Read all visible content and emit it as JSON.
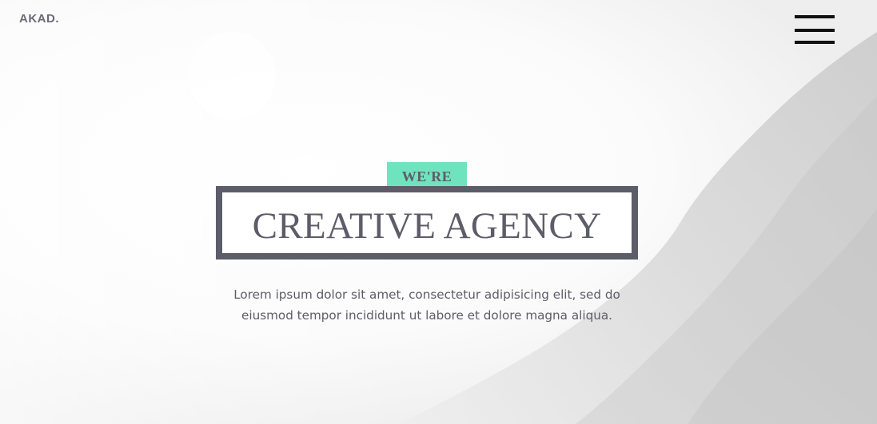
{
  "brand": {
    "logo_text": "AKAD."
  },
  "nav": {
    "menu_icon": "hamburger-menu-icon"
  },
  "hero": {
    "tagline": "WE'RE",
    "headline": "CREATIVE AGENCY",
    "description_line1": "Lorem ipsum dolor sit amet, consectetur adipisicing elit, sed do",
    "description_line2": "eiusmod tempor incididunt ut labore et dolore magna aliqua.",
    "background_image": "misty-forest-photo"
  },
  "colors": {
    "accent": "#6fe3bd",
    "text_dark": "#5d5c69",
    "menu_icon": "#111111"
  }
}
